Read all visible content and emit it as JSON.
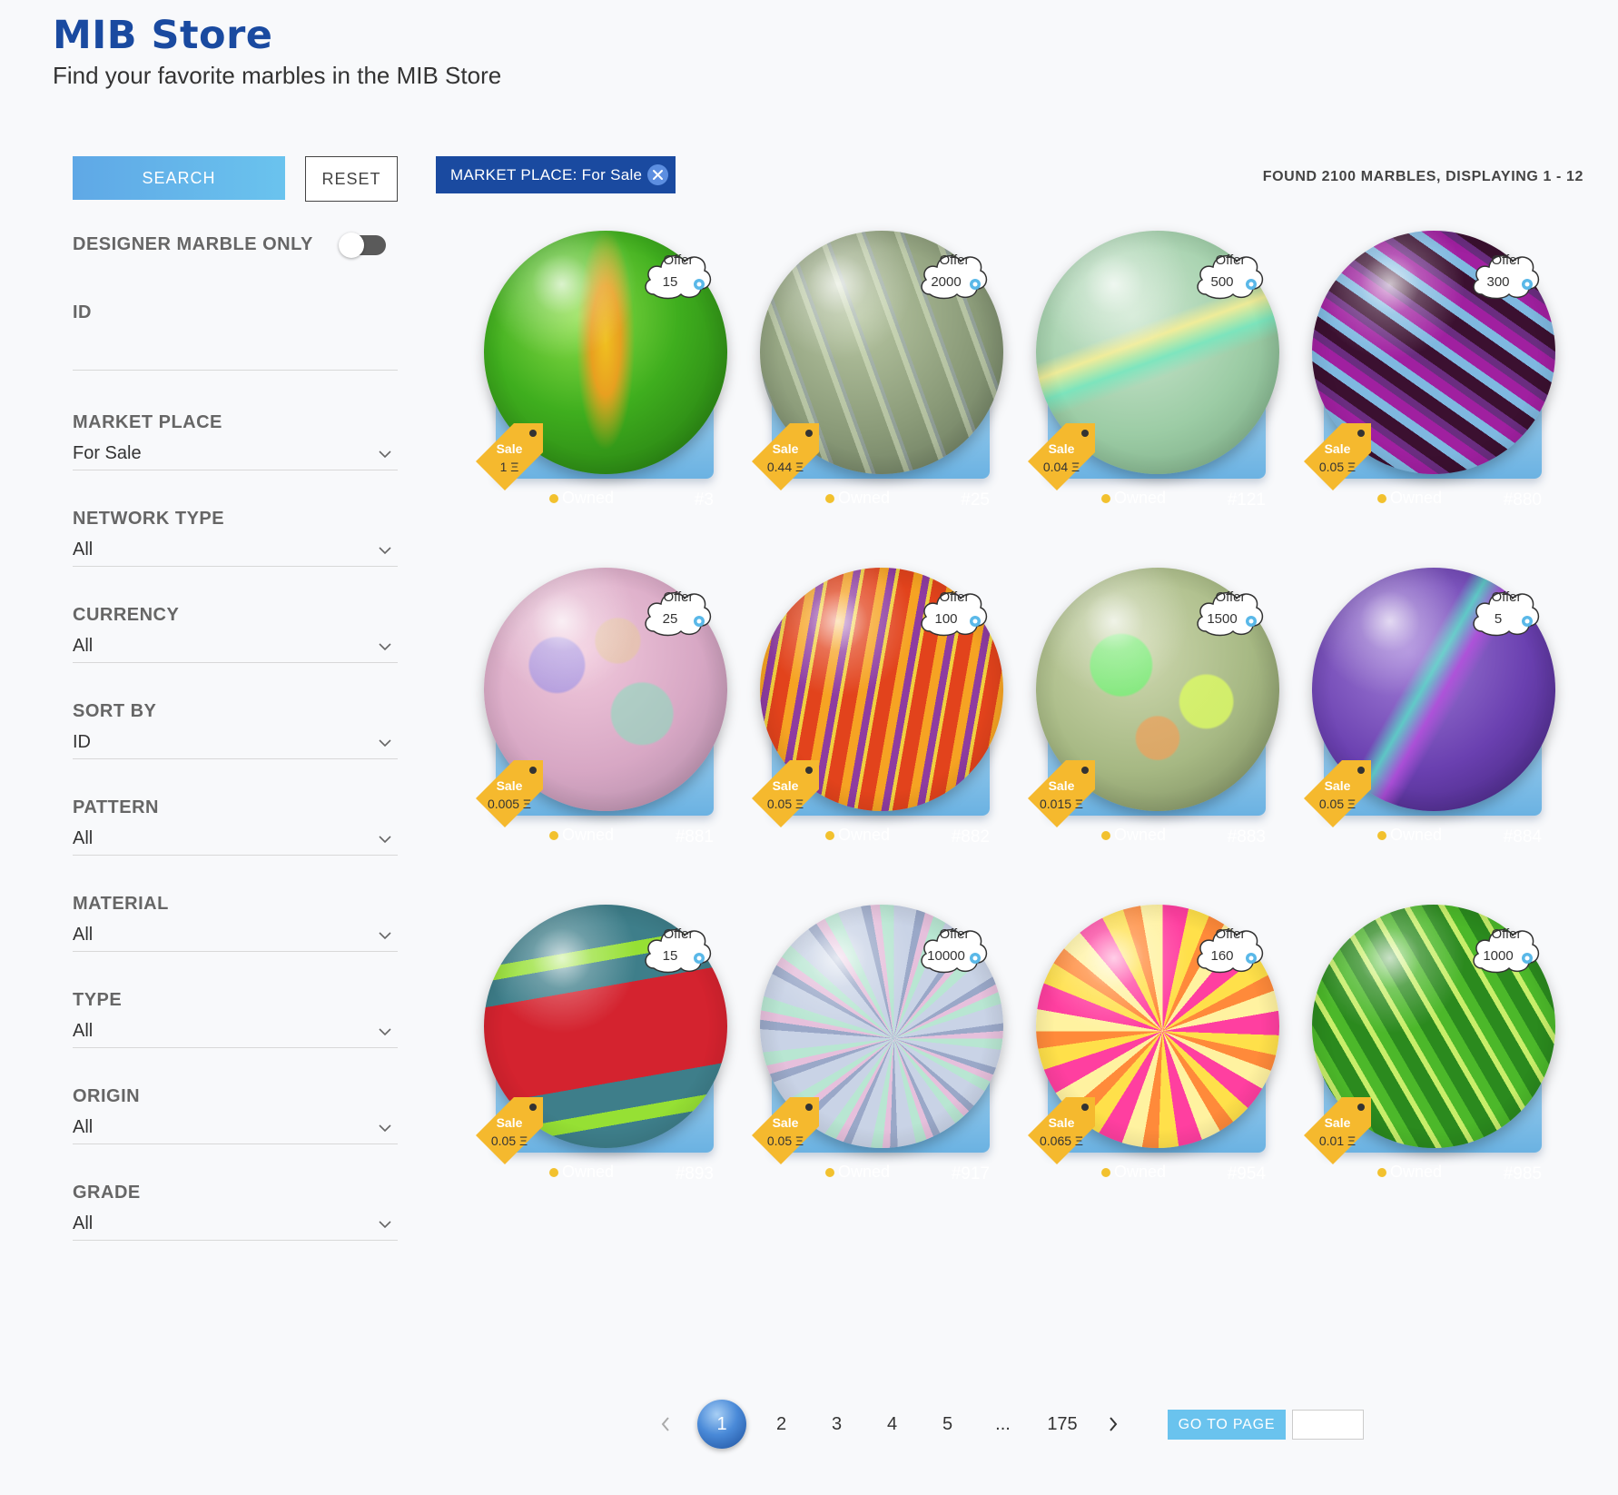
{
  "header": {
    "title": "MIB Store",
    "subtitle": "Find your favorite marbles in the MIB Store"
  },
  "sidebar": {
    "search_label": "SEARCH",
    "reset_label": "RESET",
    "designer_toggle_label": "DESIGNER MARBLE ONLY",
    "designer_toggle_on": false,
    "id_label": "ID",
    "id_value": "",
    "filters": [
      {
        "label": "MARKET PLACE",
        "value": "For Sale"
      },
      {
        "label": "NETWORK TYPE",
        "value": "All"
      },
      {
        "label": "CURRENCY",
        "value": "All"
      },
      {
        "label": "SORT BY",
        "value": "ID"
      },
      {
        "label": "PATTERN",
        "value": "All"
      },
      {
        "label": "MATERIAL",
        "value": "All"
      },
      {
        "label": "TYPE",
        "value": "All"
      },
      {
        "label": "ORIGIN",
        "value": "All"
      },
      {
        "label": "GRADE",
        "value": "All"
      }
    ]
  },
  "chip": {
    "label": "MARKET PLACE: For Sale"
  },
  "results": {
    "text": "FOUND 2100 MARBLES, DISPLAYING 1 - 12"
  },
  "cards_common": {
    "offer_label": "Offer",
    "sale_label": "Sale",
    "owned_label": "Owned"
  },
  "marbles": [
    {
      "id": "#3",
      "offer": "15",
      "sale": "1 Ξ",
      "style": "green-flame"
    },
    {
      "id": "#25",
      "offer": "2000",
      "sale": "0.44 Ξ",
      "style": "sage-swirl"
    },
    {
      "id": "#121",
      "offer": "500",
      "sale": "0.04 Ξ",
      "style": "mint-ribbon"
    },
    {
      "id": "#880",
      "offer": "300",
      "sale": "0.05 Ξ",
      "style": "purple-stripes"
    },
    {
      "id": "#881",
      "offer": "25",
      "sale": "0.005 Ξ",
      "style": "pastel-camo"
    },
    {
      "id": "#882",
      "offer": "100",
      "sale": "0.05 Ξ",
      "style": "orange-stripes"
    },
    {
      "id": "#883",
      "offer": "1500",
      "sale": "0.015 Ξ",
      "style": "green-splash"
    },
    {
      "id": "#884",
      "offer": "5",
      "sale": "0.05 Ξ",
      "style": "violet-ribbon"
    },
    {
      "id": "#893",
      "offer": "15",
      "sale": "0.05 Ξ",
      "style": "red-teal-bands"
    },
    {
      "id": "#917",
      "offer": "10000",
      "sale": "0.05 Ξ",
      "style": "silver-spiral"
    },
    {
      "id": "#954",
      "offer": "160",
      "sale": "0.065 Ξ",
      "style": "pink-flower"
    },
    {
      "id": "#985",
      "offer": "1000",
      "sale": "0.01 Ξ",
      "style": "green-leaf"
    }
  ],
  "pagination": {
    "current": "1",
    "pages": [
      "2",
      "3",
      "4",
      "5"
    ],
    "ellipsis": "...",
    "last": "175",
    "goto_label": "GO TO PAGE",
    "goto_value": ""
  },
  "colors": {
    "brand": "#1a4aa0",
    "accent": "#6ac3ee",
    "sale_tag": "#f5b92e",
    "card_base": "#6bb2e2"
  }
}
